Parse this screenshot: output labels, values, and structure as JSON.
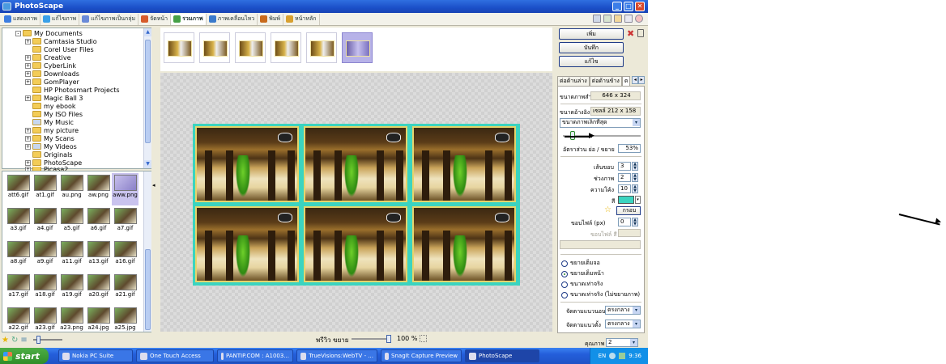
{
  "window": {
    "title": "PhotoScape"
  },
  "menu_tabs": [
    {
      "label": "แสดงภาพ",
      "color": "#3d7de0"
    },
    {
      "label": "แก้ไขภาพ",
      "color": "#3aa0e8"
    },
    {
      "label": "แก้ไขภาพเป็นกลุ่ม",
      "color": "#6a8ad8"
    },
    {
      "label": "จัดหน้า",
      "color": "#d65b2c"
    },
    {
      "label": "รวมภาพ",
      "color": "#46a046"
    },
    {
      "label": "ภาพเคลื่อนไหว",
      "color": "#3a7acc"
    },
    {
      "label": "พิมพ์",
      "color": "#c86a1c"
    },
    {
      "label": "หน้าหลัก",
      "color": "#d8a030"
    }
  ],
  "folder_tree": [
    {
      "label": "My Documents",
      "level": 0,
      "expand": "-"
    },
    {
      "label": "Camtasia Studio",
      "level": 1,
      "expand": "+"
    },
    {
      "label": "Corel User Files",
      "level": 1,
      "expand": ""
    },
    {
      "label": "Creative",
      "level": 1,
      "expand": "+"
    },
    {
      "label": "CyberLink",
      "level": 1,
      "expand": "+"
    },
    {
      "label": "Downloads",
      "level": 1,
      "expand": "+"
    },
    {
      "label": "GomPlayer",
      "level": 1,
      "expand": "+"
    },
    {
      "label": "HP Photosmart Projects",
      "level": 1,
      "expand": ""
    },
    {
      "label": "Magic Ball 3",
      "level": 1,
      "expand": "+"
    },
    {
      "label": "my ebook",
      "level": 1,
      "expand": ""
    },
    {
      "label": "My ISO Files",
      "level": 1,
      "expand": ""
    },
    {
      "label": "My Music",
      "level": 1,
      "expand": ""
    },
    {
      "label": "my picture",
      "level": 1,
      "expand": "+"
    },
    {
      "label": "My Scans",
      "level": 1,
      "expand": "+"
    },
    {
      "label": "My Videos",
      "level": 1,
      "expand": "+"
    },
    {
      "label": "Originals",
      "level": 1,
      "expand": ""
    },
    {
      "label": "PhotoScape",
      "level": 1,
      "expand": "+"
    },
    {
      "label": "Picasa2",
      "level": 1,
      "expand": "+"
    }
  ],
  "files": [
    {
      "name": "att6.gif"
    },
    {
      "name": "at1.gif"
    },
    {
      "name": "au.png"
    },
    {
      "name": "aw.png"
    },
    {
      "name": "aww.png",
      "selected": true
    },
    {
      "name": "a3.gif"
    },
    {
      "name": "a4.gif"
    },
    {
      "name": "a5.gif"
    },
    {
      "name": "a6.gif"
    },
    {
      "name": "a7.gif"
    },
    {
      "name": "a8.gif"
    },
    {
      "name": "a9.gif"
    },
    {
      "name": "a11.gif"
    },
    {
      "name": "a13.gif"
    },
    {
      "name": "a16.gif"
    },
    {
      "name": "a17.gif"
    },
    {
      "name": "a18.gif"
    },
    {
      "name": "a19.gif"
    },
    {
      "name": "a20.gif"
    },
    {
      "name": "a21.gif"
    },
    {
      "name": "a22.gif"
    },
    {
      "name": "a23.gif"
    },
    {
      "name": "a23.png"
    },
    {
      "name": "a24.jpg"
    },
    {
      "name": "a25.jpg"
    }
  ],
  "strip_thumbs": 6,
  "strip_selected_index": 5,
  "collage": {
    "rows": 2,
    "cols": 3,
    "border_color": "#3bd4c0"
  },
  "zoom": {
    "label": "พรีวิว ขยาย",
    "value": "100 %",
    "level": 1.0
  },
  "right_panel": {
    "buttons": {
      "add": "เพิ่ม",
      "save": "บันทึก",
      "edit": "แก้ไข"
    },
    "tabs": [
      "ต่อด้านล่าง",
      "ต่อด้านข้าง",
      "ต"
    ],
    "result_label": "ขนาดภาพสำเร็จ",
    "result_value": "646 x 324",
    "ref_label": "ขนาดอ้างอิง",
    "ref_value": "เซลล์ 212 x 158",
    "size_option": "ขนาดภาพเล็กที่สุด",
    "size_slider_fraction": 0.1,
    "ratio_label": "อัตราส่วน ย่อ / ขยาย",
    "ratio_value": "53%",
    "border_label": "เส้นขอบ",
    "border_value": "3",
    "gap_label": "ช่วงภาพ",
    "gap_value": "2",
    "curve_label": "ความโค้ง",
    "curve_value": "10",
    "color_label": "สี",
    "color_value": "#3bd4c0",
    "frame_button": "กรอบ",
    "margin_label": "ขอบไฟล์ (px)",
    "margin_value": "0",
    "margin_color_label": "ขอบไฟล์ สี",
    "radio_options": [
      {
        "label": "ขยายเต็มจอ",
        "checked": false
      },
      {
        "label": "ขยายเต็มหน้า",
        "checked": true
      },
      {
        "label": "ขนาดเท่าจริง",
        "checked": false
      },
      {
        "label": "ขนาดเท่าจริง (ไม่ขยายภาพ)",
        "checked": false
      }
    ],
    "halign_label": "จัดตามแนวนอน",
    "halign_value": "ตรงกลาง",
    "valign_label": "จัดตามแนวตั้ง",
    "valign_value": "ตรงกลาง",
    "quality_label": "คุณภาพ",
    "quality_value": "2"
  },
  "taskbar": {
    "start": "start",
    "tasks": [
      {
        "label": "Nokia PC Suite"
      },
      {
        "label": "One Touch Access"
      },
      {
        "label": "PANTIP.COM : A1003..."
      },
      {
        "label": "TrueVisions:WebTV - ..."
      },
      {
        "label": "SnagIt Capture Preview"
      },
      {
        "label": "PhotoScape",
        "active": true
      }
    ],
    "lang": "EN",
    "clock": "9:36"
  }
}
